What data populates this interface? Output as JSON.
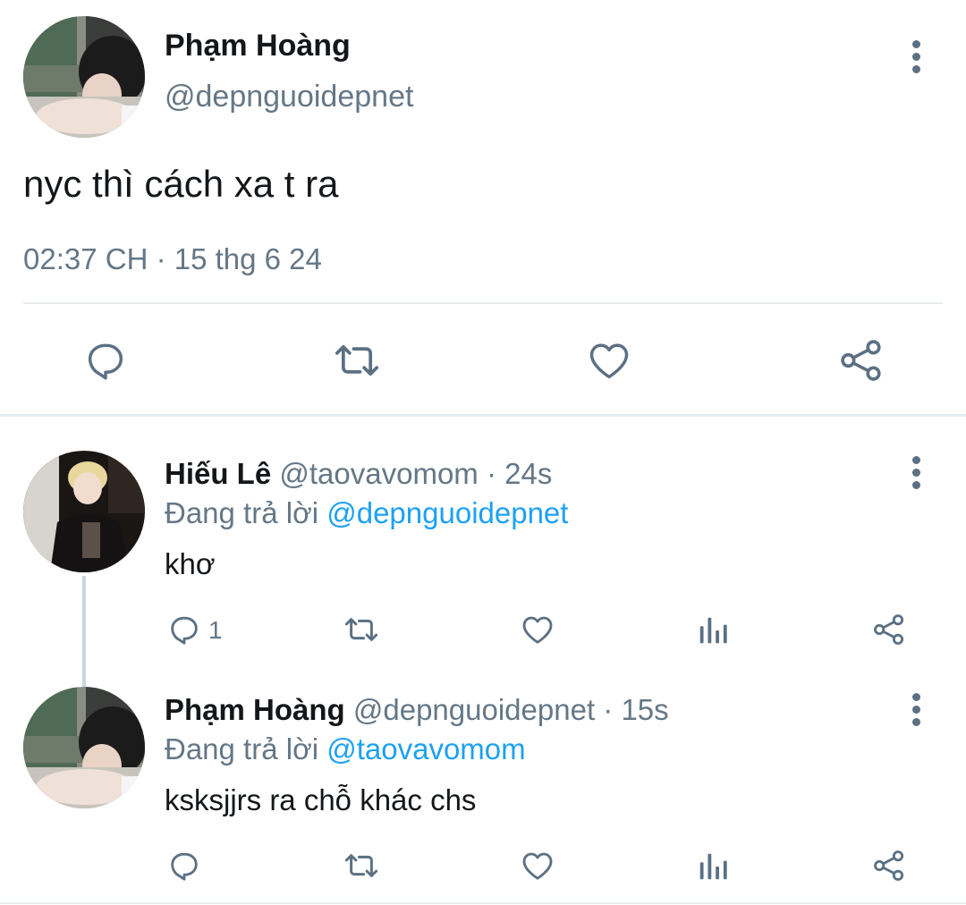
{
  "main_tweet": {
    "author_name": "Phạm Hoàng",
    "author_handle": "@depnguoidepnet",
    "text": "nyc thì cách xa t ra",
    "timestamp": "02:37 CH · 15 thg 6 24",
    "actions": [
      "reply-icon",
      "retweet-icon",
      "like-icon",
      "share-icon"
    ]
  },
  "replies": [
    {
      "author_name": "Hiếu Lê",
      "author_handle": "@taovavomom",
      "time_ago": "· 24s",
      "replying_prefix": "Đang trả lời",
      "replying_to": "@depnguoidepnet",
      "text": "khơ",
      "reply_count": "1",
      "actions": [
        "reply-icon",
        "retweet-icon",
        "like-icon",
        "analytics-icon",
        "share-icon"
      ]
    },
    {
      "author_name": "Phạm Hoàng",
      "author_handle": "@depnguoidepnet",
      "time_ago": "· 15s",
      "replying_prefix": "Đang trả lời",
      "replying_to": "@taovavomom",
      "text": "ksksjjrs ra chỗ khác chs",
      "reply_count": "",
      "actions": [
        "reply-icon",
        "retweet-icon",
        "like-icon",
        "analytics-icon",
        "share-icon"
      ]
    }
  ],
  "colors": {
    "text": "#14171a",
    "muted": "#657786",
    "link": "#1da1f2",
    "icon": "#5b7083",
    "divider": "#e6ecf0"
  }
}
